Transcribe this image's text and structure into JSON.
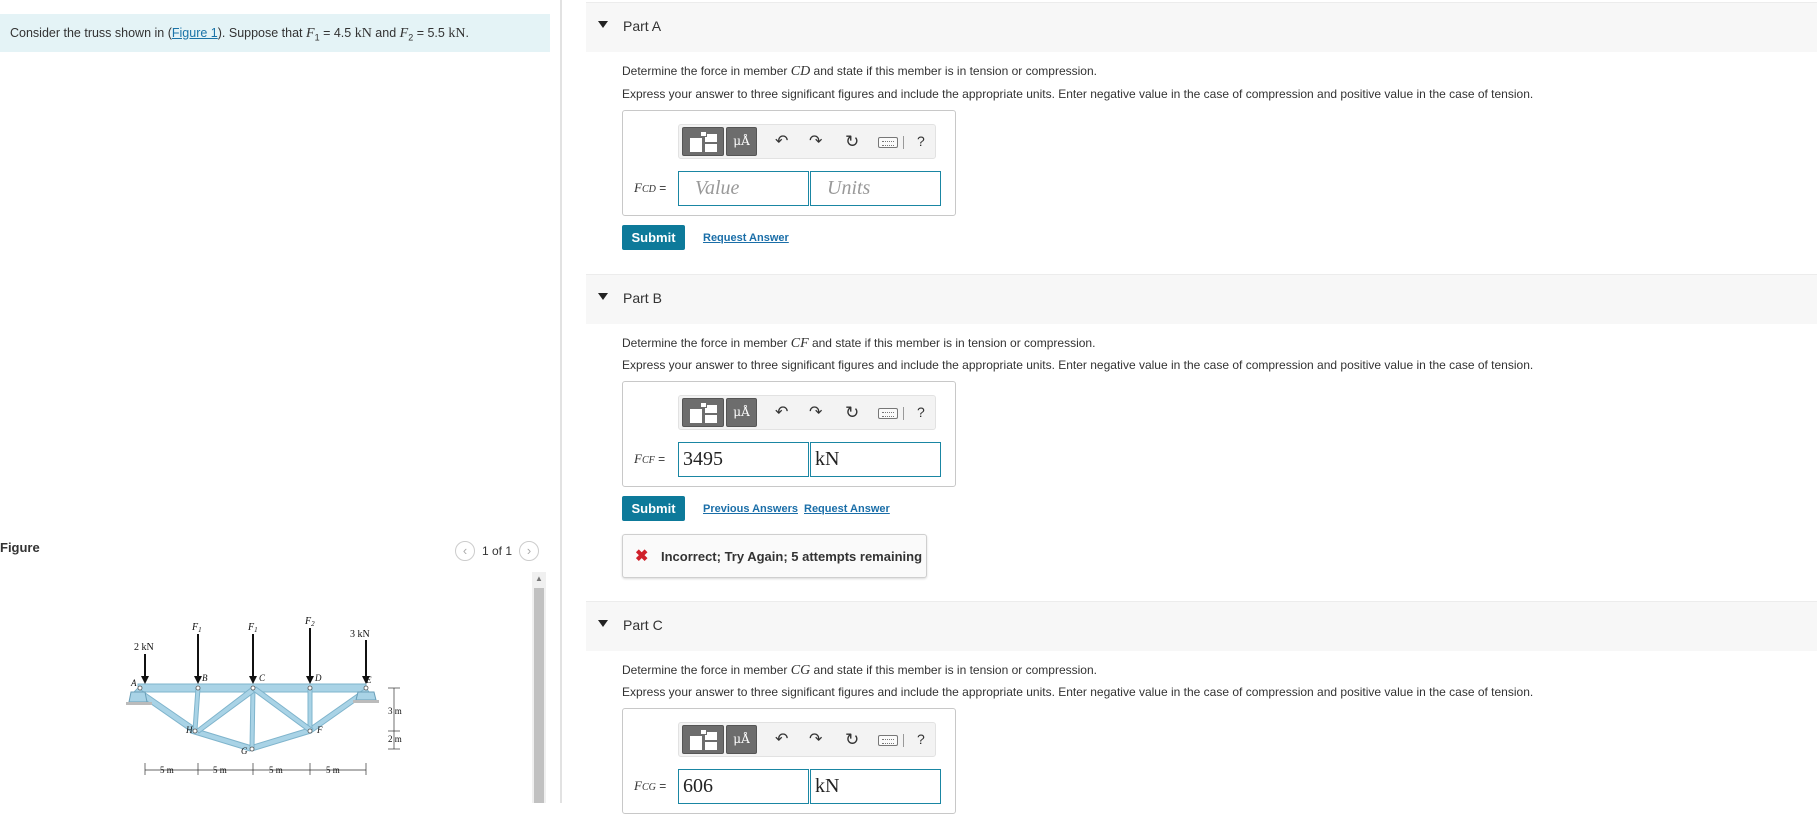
{
  "problem": {
    "before_link": "Consider the truss shown in (",
    "link": "Figure 1",
    "after_link": "). Suppose that ",
    "f1_symbol": "F",
    "f1_sub": "1",
    "f1_value": " = 4.5 ",
    "f1_unit": "kN",
    "and_text": " and ",
    "f2_symbol": "F",
    "f2_sub": "2",
    "f2_value": " = 5.5 ",
    "f2_unit": "kN",
    "end": "."
  },
  "figure": {
    "label": "Figure",
    "pager": "1 of 1",
    "loads": {
      "left": "2 kN",
      "right": "3 kN",
      "f1a": "F",
      "f1b": "F",
      "f2": "F",
      "f1a_sub": "1",
      "f1b_sub": "1",
      "f2_sub": "2"
    },
    "nodes": {
      "a": "A",
      "b": "B",
      "c": "C",
      "d": "D",
      "e": "E",
      "f": "F",
      "g": "G",
      "h": "H"
    },
    "dims": {
      "d1": "5 m",
      "d2": "5 m",
      "d3": "5 m",
      "d4": "5 m",
      "h1": "3 m",
      "h2": "2 m"
    }
  },
  "common": {
    "instruction": "Express your answer to three significant figures and include the appropriate units. Enter negative value in the case of compression and positive value in the case of tension.",
    "toolbar_units_btn": "μÅ",
    "toolbar_help": "?",
    "submit": "Submit",
    "request_answer": "Request Answer",
    "previous_answers": "Previous Answers",
    "value_placeholder": "Value",
    "units_placeholder": "Units",
    "eq": " ="
  },
  "parts": [
    {
      "title": "Part A",
      "prompt_pre": "Determine the force in member ",
      "member": "CD",
      "prompt_post": " and state if this member is in tension or compression.",
      "label": "F",
      "label_sub": "CD",
      "value": "",
      "units": ""
    },
    {
      "title": "Part B",
      "prompt_pre": "Determine the force in member ",
      "member": "CF",
      "prompt_post": " and state if this member is in tension or compression.",
      "label": "F",
      "label_sub": "CF",
      "value": "3495",
      "units": "kN"
    },
    {
      "title": "Part C",
      "prompt_pre": "Determine the force in member ",
      "member": "CG",
      "prompt_post": " and state if this member is in tension or compression.",
      "label": "F",
      "label_sub": "CG",
      "value": "606",
      "units": "kN"
    }
  ],
  "feedback": {
    "message": "Incorrect; Try Again; 5 attempts remaining",
    "icon": "close-icon",
    "color": "#d0202a"
  },
  "colors": {
    "accent": "#0d7a9a",
    "link": "#1a6ea8",
    "truss": "#a9d3e6",
    "statement_bg": "#e4f3f6"
  }
}
